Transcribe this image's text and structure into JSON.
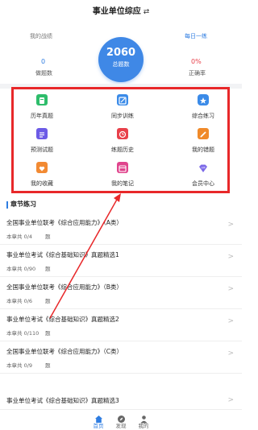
{
  "header": {
    "title": "事业单位综应",
    "swap_icon": "⇄"
  },
  "stats": {
    "left_label": "我的战绩",
    "left_value": "0",
    "left_sub": "做题数",
    "center_value": "2060",
    "center_label": "总题数",
    "right_label": "每日一练",
    "right_value": "0%",
    "right_sub": "正确率",
    "colors": {
      "circle": "#3f88e6",
      "left_value": "#2f7de1",
      "right_value": "#e8404a",
      "right_label": "#2f7de1"
    }
  },
  "grid": {
    "highlight_color": "#e8282a",
    "tiles": [
      {
        "label": "历年真题",
        "icon": "book-icon",
        "color": "#2ebd6b"
      },
      {
        "label": "同步训练",
        "icon": "edit-pad-icon",
        "color": "#3b8be8"
      },
      {
        "label": "综合练习",
        "icon": "star-hexagon-icon",
        "color": "#3b8be8"
      },
      {
        "label": "预测试题",
        "icon": "list-icon",
        "color": "#6c5be6"
      },
      {
        "label": "练题历史",
        "icon": "history-icon",
        "color": "#e8404a"
      },
      {
        "label": "我的错题",
        "icon": "pencil-icon",
        "color": "#f08a2a"
      },
      {
        "label": "我的收藏",
        "icon": "heart-folder-icon",
        "color": "#f28a33"
      },
      {
        "label": "我的笔记",
        "icon": "calendar-icon",
        "color": "#e0458d"
      },
      {
        "label": "会员中心",
        "icon": "vip-diamond-icon",
        "color": "#7b68e8"
      }
    ]
  },
  "section": {
    "title": "章节练习"
  },
  "list": [
    {
      "title": "全国事业单位联考《综合应用能力》（A类）",
      "count": "本章共 0/4",
      "unit": "题"
    },
    {
      "title": "事业单位考试《综合基础知识》真题精选1",
      "count": "本章共 0/90",
      "unit": "题"
    },
    {
      "title": "全国事业单位联考《综合应用能力》（B类）",
      "count": "本章共 0/6",
      "unit": "题"
    },
    {
      "title": "事业单位考试《综合基础知识》真题精选2",
      "count": "本章共 0/110",
      "unit": "题"
    },
    {
      "title": "全国事业单位联考《综合应用能力》（C类）",
      "count": "本章共 0/9",
      "unit": "题"
    },
    {
      "title": "事业单位考试《综合基础知识》真题精选3",
      "count": "",
      "unit": ""
    }
  ],
  "chevron": ">",
  "tabbar": {
    "items": [
      {
        "label": "首页",
        "icon": "home-icon",
        "active": true
      },
      {
        "label": "发现",
        "icon": "compass-icon",
        "active": false
      },
      {
        "label": "我的",
        "icon": "person-icon",
        "active": false
      }
    ],
    "active_color": "#2f7de1",
    "inactive_color": "#666666"
  }
}
